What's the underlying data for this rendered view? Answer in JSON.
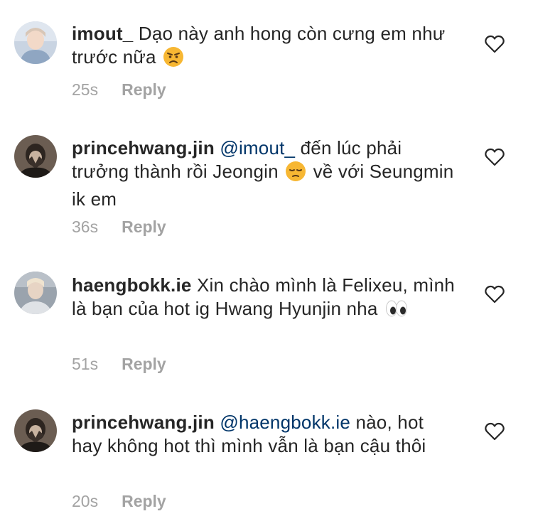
{
  "comments": [
    {
      "username": "imout_",
      "text_before": " Dạo này anh hong còn cưng em như trước nữa ",
      "emoji": "angry-face",
      "time": "25s",
      "reply_label": "Reply"
    },
    {
      "username": "princehwang.jin",
      "mention": "@imout_",
      "text_before": " đến lúc phải trưởng thành rồi Jeongin ",
      "emoji": "pensive-face",
      "text_after": " về với Seungmin ik em",
      "time": "36s",
      "reply_label": "Reply"
    },
    {
      "username": "haengbokk.ie",
      "text_before": " Xin chào mình là Felixeu, mình là bạn của hot ig Hwang Hyunjin nha ",
      "emoji": "eyes",
      "time": "51s",
      "reply_label": "Reply"
    },
    {
      "username": "princehwang.jin",
      "mention": "@haengbokk.ie",
      "text_before": " nào, hot hay không hot thì mình vẫn là bạn cậu thôi",
      "time": "20s",
      "reply_label": "Reply"
    }
  ],
  "colors": {
    "text": "#262626",
    "mention": "#003569",
    "meta": "#a3a3a3",
    "heart_stroke": "#262626"
  },
  "icons": {
    "like": "heart-outline-icon"
  }
}
